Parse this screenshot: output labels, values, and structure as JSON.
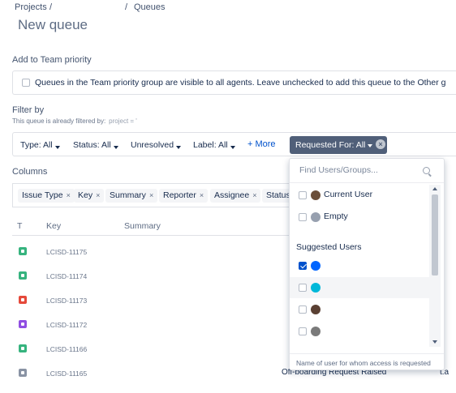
{
  "breadcrumb": {
    "projects": "Projects",
    "sep": "/",
    "queues": "Queues"
  },
  "page_title": "New queue",
  "team": {
    "label": "Add to Team priority",
    "checkbox_text": "Queues in the Team priority group are visible to all agents. Leave unchecked to add this queue to the Other g"
  },
  "filter": {
    "label": "Filter by",
    "sub_label": "This queue is already filtered by:",
    "sub_value": "project = '",
    "items": [
      {
        "label": "Type: All"
      },
      {
        "label": "Status: All"
      },
      {
        "label": "Unresolved"
      },
      {
        "label": "Label: All"
      }
    ],
    "more": "+ More",
    "requested_for": "Requested For: All",
    "clear_glyph": "×"
  },
  "columns": {
    "label": "Columns",
    "chips": [
      {
        "label": "Issue Type"
      },
      {
        "label": "Key"
      },
      {
        "label": "Summary"
      },
      {
        "label": "Reporter"
      },
      {
        "label": "Assignee"
      },
      {
        "label": "Status"
      }
    ],
    "remove_glyph": "×"
  },
  "table": {
    "headers": {
      "type": "T",
      "key": "Key",
      "summary": "Summary"
    },
    "rows": [
      {
        "key": "LCISD-11175",
        "type_color": "#36b37e"
      },
      {
        "key": "LCISD-11174",
        "type_color": "#36b37e"
      },
      {
        "key": "LCISD-11173",
        "type_color": "#e5493a"
      },
      {
        "key": "LCISD-11172",
        "type_color": "#904ee2"
      },
      {
        "key": "LCISD-11166",
        "type_color": "#36b37e"
      },
      {
        "key": "LCISD-11165",
        "type_color": "#8993a4"
      }
    ],
    "visible_summary": "Off-boarding Request Raised",
    "visible_tail": "t.a"
  },
  "dropdown": {
    "search_placeholder": "Find Users/Groups...",
    "options": [
      {
        "name": "Current User",
        "checked": false,
        "avatar_color": "#6b4f3a"
      },
      {
        "name": "Empty",
        "checked": false,
        "avatar_color": "#97a0af"
      }
    ],
    "suggested_heading": "Suggested Users",
    "suggested": [
      {
        "checked": true,
        "avatar_color": "#0065ff"
      },
      {
        "checked": false,
        "avatar_color": "#00b8d9"
      },
      {
        "checked": false,
        "avatar_color": "#5a4033"
      },
      {
        "checked": false,
        "avatar_color": "#7a7a7a"
      }
    ],
    "footer": "Name of user for whom access is requested"
  }
}
